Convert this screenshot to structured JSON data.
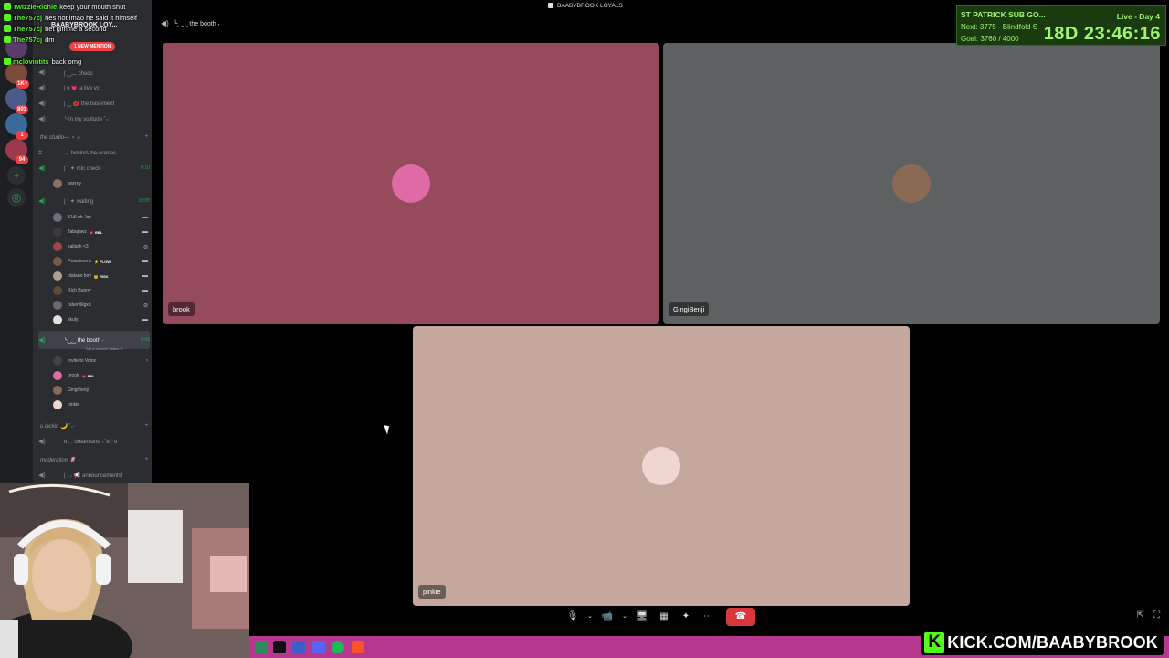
{
  "window": {
    "title": "BAABYBROOK LOYALS"
  },
  "server_rail": {
    "badges": [
      "1K+",
      "803",
      "1",
      "94"
    ]
  },
  "sidebar": {
    "server_name": "BAABYBROOK LOY...",
    "mention_pill": "1 NEW MENTION",
    "channels": [
      {
        "label": "| ‿︵ chaos",
        "live": false
      },
      {
        "label": "| ɞ 💗 a live vc",
        "live": false
      },
      {
        "label": "| ‿ 💋 the basement",
        "live": false
      },
      {
        "label": "╰ in my solitude ˚₊‧",
        "live": false
      }
    ],
    "category_studio": "the studio— ⋆ ⊹",
    "studio_channels": [
      {
        "label": "⸝⸝ behind-the-scenes",
        "type": "text",
        "live": false
      },
      {
        "label": "| ˚ ✦ mic check",
        "type": "voice",
        "live": true,
        "timer": "0:10"
      }
    ],
    "mic_check_users": [
      {
        "name": "worrny"
      }
    ],
    "waiting_channel": {
      "label": "| ˚ ✦ waiting",
      "timer": "19:05"
    },
    "waiting_users": [
      {
        "name": "414Luh.Jay",
        "tag": ""
      },
      {
        "name": "Jabajawz",
        "tag": "💗 BBL"
      },
      {
        "name": "kailash <3",
        "tag": ""
      },
      {
        "name": "Peachesmk",
        "tag": "⚡ FLOW"
      },
      {
        "name": "platano boy",
        "tag": "👑 RISK"
      },
      {
        "name": "Rich Bunny",
        "tag": ""
      },
      {
        "name": "ruben/lilgxd",
        "tag": ""
      },
      {
        "name": "skuly",
        "tag": ""
      }
    ],
    "booth_channel": {
      "label": "╰‿‿ the booth ˖",
      "timer": "0:06",
      "status": "Set a channel status ✎"
    },
    "booth_users": [
      {
        "name": "Invite to Voice",
        "tag": ""
      },
      {
        "name": "brook",
        "tag": "💗 BBL"
      },
      {
        "name": "GingiBenji",
        "tag": ""
      },
      {
        "name": "pinkie",
        "tag": ""
      }
    ],
    "category_lackin": "u lackin 🌙 ˚₊‧",
    "lackin_channels": [
      {
        "label": "ɞ . . dreamland ₊˚ʚ♡ɞ"
      }
    ],
    "category_moderation": "moderation 🌷 ·",
    "moderation_channels": [
      {
        "label": "| ⸝⸝ 📢 announcements!"
      }
    ]
  },
  "chat": [
    {
      "user": "TwizzieRichie",
      "text": "keep your mouth shut"
    },
    {
      "user": "The757cj",
      "text": "hes not lmao he said it himself"
    },
    {
      "user": "The757cj",
      "text": "bet gimme a second"
    },
    {
      "user": "The757cj",
      "text": "dm"
    },
    {
      "user": "mclovintits",
      "text": "back omg"
    }
  ],
  "call": {
    "channel_name": "╰‿‿ the booth ˖",
    "participants": [
      {
        "name": "brook",
        "bg": "#964b5c",
        "avatar_color": "#e06aa6"
      },
      {
        "name": "GingiBenji",
        "bg": "#5d6161",
        "avatar_color": "#8a6a55"
      },
      {
        "name": "pinkie",
        "bg": "#c4a89e",
        "avatar_color": "#f0d6d0"
      }
    ]
  },
  "controls": {
    "mic": "🎙",
    "mic_menu": "⌄",
    "camera": "📹",
    "camera_menu": "⌄",
    "screen_share": "🖥",
    "activities": "▦",
    "soundboard": "✦",
    "more": "⋯",
    "disconnect": "☎",
    "popout": "⇱",
    "fullscreen": "⛶"
  },
  "subathon": {
    "title": "ST PATRICK SUB GO...",
    "live_label": "Live - Day 4",
    "next": "Next: 3775 - Blindfold S",
    "goal": "Goal: 3760 / 4000",
    "timer": "18D  23:46:16"
  },
  "banner": {
    "logo": "K",
    "url": "KICK.COM/BAABYBROOK"
  },
  "colors": {
    "kick_green": "#53fc18",
    "discord_bg": "#2b2d31",
    "taskbar": "#b5378f",
    "end_call": "#da373c"
  }
}
